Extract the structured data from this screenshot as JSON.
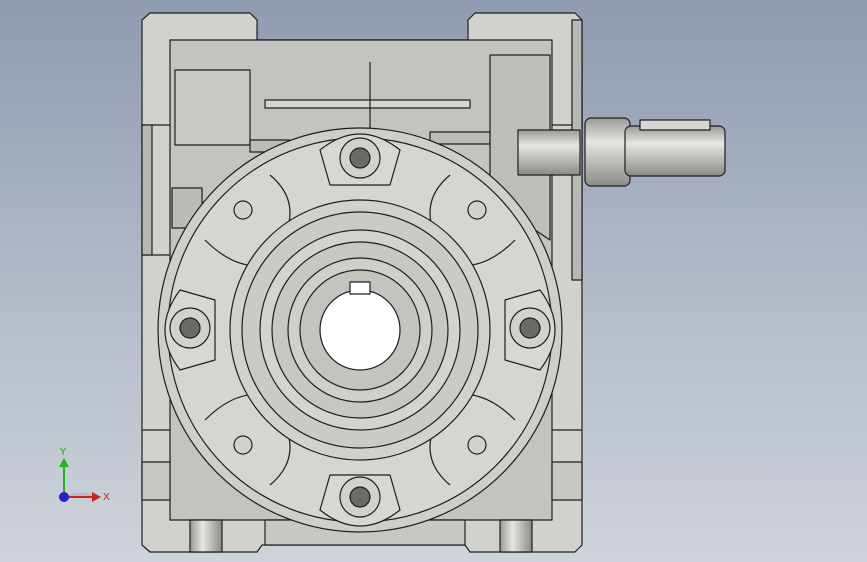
{
  "viewport": {
    "background_top": "#8f9bb0",
    "background_bottom": "#cfd3db"
  },
  "model": {
    "name_icon": "worm-gearbox-front-view",
    "body_color": "#d2d2cc",
    "edge_color": "#1e1e1e"
  },
  "triad": {
    "y_label": "Y",
    "x_label": "X",
    "x_color": "#d02020",
    "y_color": "#20b020",
    "z_color": "#2020d0"
  }
}
